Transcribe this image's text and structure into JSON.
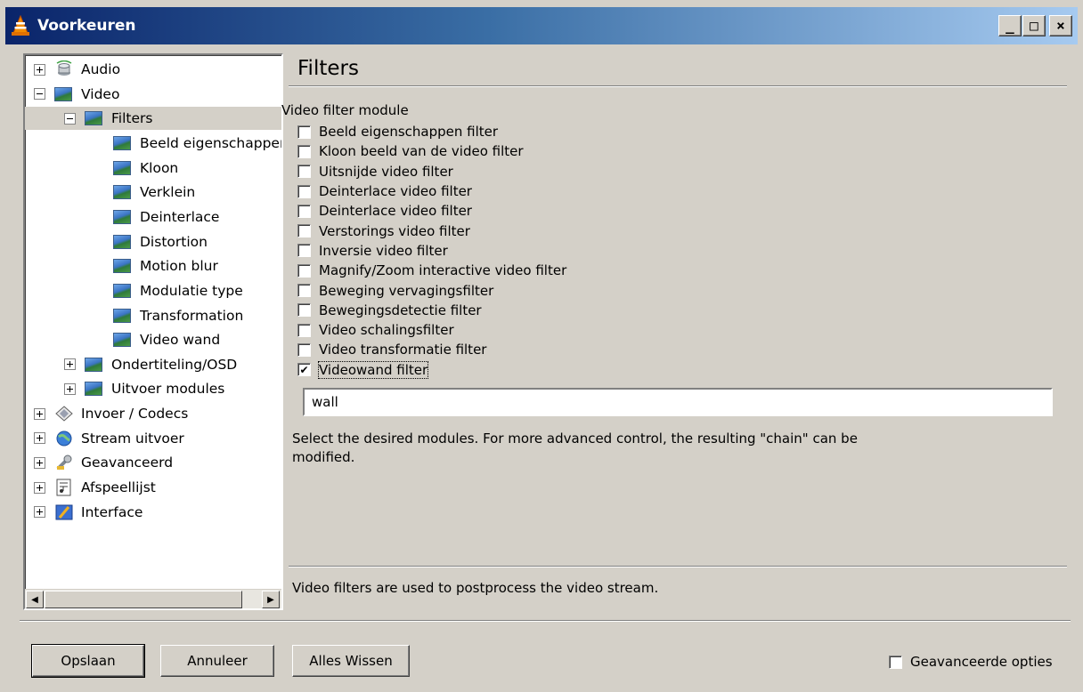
{
  "window": {
    "title": "Voorkeuren",
    "icon": "vlc-cone-icon",
    "controls": {
      "minimize": "_",
      "maximize": "□",
      "close": "×"
    }
  },
  "tree": {
    "items": [
      {
        "label": "Audio",
        "expander": "+",
        "icon": "speaker-icon",
        "level": 0
      },
      {
        "label": "Video",
        "expander": "-",
        "icon": "video-image-icon",
        "level": 0
      },
      {
        "label": "Filters",
        "expander": "-",
        "icon": "video-image-icon",
        "level": 1,
        "selected": true
      },
      {
        "label": "Beeld eigenschappen",
        "icon": "video-image-icon",
        "level": 2
      },
      {
        "label": "Kloon",
        "icon": "video-image-icon",
        "level": 2
      },
      {
        "label": "Verklein",
        "icon": "video-image-icon",
        "level": 2
      },
      {
        "label": "Deinterlace",
        "icon": "video-image-icon",
        "level": 2
      },
      {
        "label": "Distortion",
        "icon": "video-image-icon",
        "level": 2
      },
      {
        "label": "Motion blur",
        "icon": "video-image-icon",
        "level": 2
      },
      {
        "label": "Modulatie type",
        "icon": "video-image-icon",
        "level": 2
      },
      {
        "label": "Transformation",
        "icon": "video-image-icon",
        "level": 2
      },
      {
        "label": "Video wand",
        "icon": "video-image-icon",
        "level": 2
      },
      {
        "label": "Ondertiteling/OSD",
        "expander": "+",
        "icon": "video-image-icon",
        "level": 1
      },
      {
        "label": "Uitvoer modules",
        "expander": "+",
        "icon": "video-image-icon",
        "level": 1
      },
      {
        "label": "Invoer / Codecs",
        "expander": "+",
        "icon": "input-codecs-icon",
        "level": 0
      },
      {
        "label": "Stream uitvoer",
        "expander": "+",
        "icon": "globe-icon",
        "level": 0
      },
      {
        "label": "Geavanceerd",
        "expander": "+",
        "icon": "wrench-icon",
        "level": 0
      },
      {
        "label": "Afspeellijst",
        "expander": "+",
        "icon": "playlist-icon",
        "level": 0
      },
      {
        "label": "Interface",
        "expander": "+",
        "icon": "interface-icon",
        "level": 0
      }
    ]
  },
  "panel": {
    "title": "Filters",
    "group_label": "Video filter module",
    "filters": [
      {
        "label": "Beeld eigenschappen filter",
        "checked": false
      },
      {
        "label": "Kloon beeld van de video filter",
        "checked": false
      },
      {
        "label": "Uitsnijde video filter",
        "checked": false
      },
      {
        "label": "Deinterlace video filter",
        "checked": false
      },
      {
        "label": "Deinterlace video filter",
        "checked": false
      },
      {
        "label": "Verstorings video filter",
        "checked": false
      },
      {
        "label": "Inversie video filter",
        "checked": false
      },
      {
        "label": "Magnify/Zoom interactive video filter",
        "checked": false
      },
      {
        "label": "Beweging vervagingsfilter",
        "checked": false
      },
      {
        "label": "Bewegingsdetectie filter",
        "checked": false
      },
      {
        "label": "Video schalingsfilter",
        "checked": false
      },
      {
        "label": "Video transformatie filter",
        "checked": false
      },
      {
        "label": "Videowand filter",
        "checked": true
      }
    ],
    "chain_value": "wall",
    "help_text": "Select the desired modules. For more advanced control, the resulting \"chain\" can be modified.",
    "description": "Video filters are used to postprocess the video stream."
  },
  "buttons": {
    "save": "Opslaan",
    "cancel": "Annuleer",
    "reset_all": "Alles Wissen"
  },
  "advanced_options": {
    "label": "Geavanceerde opties",
    "checked": false
  },
  "colors": {
    "titlebar_start": "#0a246a",
    "titlebar_end": "#a6caf0",
    "dialog_bg": "#d4d0c8"
  }
}
